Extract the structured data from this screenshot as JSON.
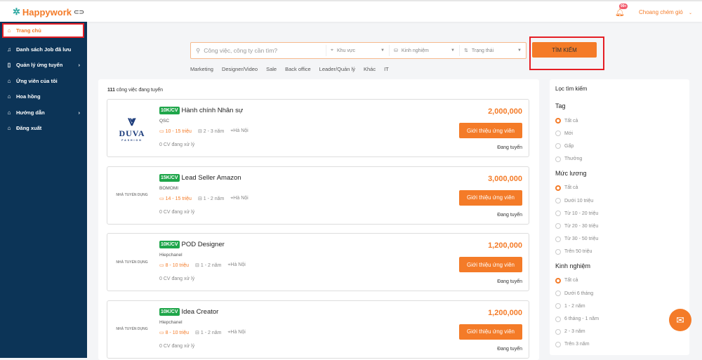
{
  "header": {
    "logo": "Happywork",
    "notif_badge": "99+",
    "user": "Choang chém gió"
  },
  "sidebar": {
    "items": [
      {
        "label": "Trang chủ",
        "icon": "home-icon"
      },
      {
        "label": "Danh sách Job đã lưu",
        "icon": "bell-icon"
      },
      {
        "label": "Quản lý ứng tuyển",
        "icon": "file-icon",
        "chevron": true
      },
      {
        "label": "Ứng viên của tôi",
        "icon": "home-icon"
      },
      {
        "label": "Hoa hồng",
        "icon": "home-icon"
      },
      {
        "label": "Hướng dẫn",
        "icon": "home-icon",
        "chevron": true
      },
      {
        "label": "Đăng xuất",
        "icon": "home-icon"
      }
    ]
  },
  "search": {
    "placeholder": "Công việc, công ty cần tìm?",
    "area": "Khu vực",
    "experience": "Kinh nghiệm",
    "status": "Trạng thái",
    "button": "TÌM KIẾM"
  },
  "tags": [
    "Marketing",
    "Designer/Video",
    "Sale",
    "Back office",
    "Leader/Quản lý",
    "Khác",
    "IT"
  ],
  "list": {
    "count": "111",
    "count_label": "công việc đang tuyển",
    "jobs": [
      {
        "badge": "10K/CV",
        "title": "Hành chính Nhân sự",
        "company": "QSC",
        "salary": "10 - 15 triệu",
        "exp": "2 - 3 năm",
        "location": "Hà Nội",
        "cv": "0 CV đang xử lý",
        "price": "2,000,000",
        "button": "Giới thiệu ứng viên",
        "status": "Đang tuyển",
        "logo": "DUVA",
        "logo_sub": "FASHION"
      },
      {
        "badge": "15K/CV",
        "title": "Lead Seller Amazon",
        "company": "BOMOMI",
        "salary": "14 - 15 triệu",
        "exp": "1 - 2 năm",
        "location": "Hà Nội",
        "cv": "0 CV đang xử lý",
        "price": "3,000,000",
        "button": "Giới thiệu ứng viên",
        "status": "Đang tuyển",
        "logo": "NHÀ TUYỂN DỤNG"
      },
      {
        "badge": "10K/CV",
        "title": "POD Designer",
        "company": "Hiepchanel",
        "salary": "8 - 10 triệu",
        "exp": "1 - 2 năm",
        "location": "Hà Nội",
        "cv": "0 CV đang xử lý",
        "price": "1,200,000",
        "button": "Giới thiệu ứng viên",
        "status": "Đang tuyển",
        "logo": "NHÀ TUYỂN DỤNG"
      },
      {
        "badge": "10K/CV",
        "title": "Idea Creator",
        "company": "Hiepchanel",
        "salary": "8 - 10 triệu",
        "exp": "1 - 2 năm",
        "location": "Hà Nội",
        "cv": "0 CV đang xử lý",
        "price": "1,200,000",
        "button": "Giới thiệu ứng viên",
        "status": "Đang tuyển",
        "logo": "NHÀ TUYỂN DỤNG"
      }
    ]
  },
  "filter": {
    "title": "Lọc tìm kiếm",
    "groups": [
      {
        "label": "Tag",
        "options": [
          "Tất cả",
          "Mới",
          "Gấp",
          "Thưởng"
        ]
      },
      {
        "label": "Mức lương",
        "options": [
          "Tất cả",
          "Dưới 10 triệu",
          "Từ 10 - 20 triệu",
          "Từ 20 - 30 triệu",
          "Từ 30 - 50 triệu",
          "Trên 50 triệu"
        ]
      },
      {
        "label": "Kinh nghiệm",
        "options": [
          "Tất cả",
          "Dưới 6 tháng",
          "1 - 2 năm",
          "6 tháng - 1 năm",
          "2 - 3 năm",
          "Trên 3 năm"
        ]
      }
    ]
  },
  "colors": {
    "accent": "#f47b28",
    "sidebar": "#0c3457",
    "badge": "#1fa64a"
  }
}
